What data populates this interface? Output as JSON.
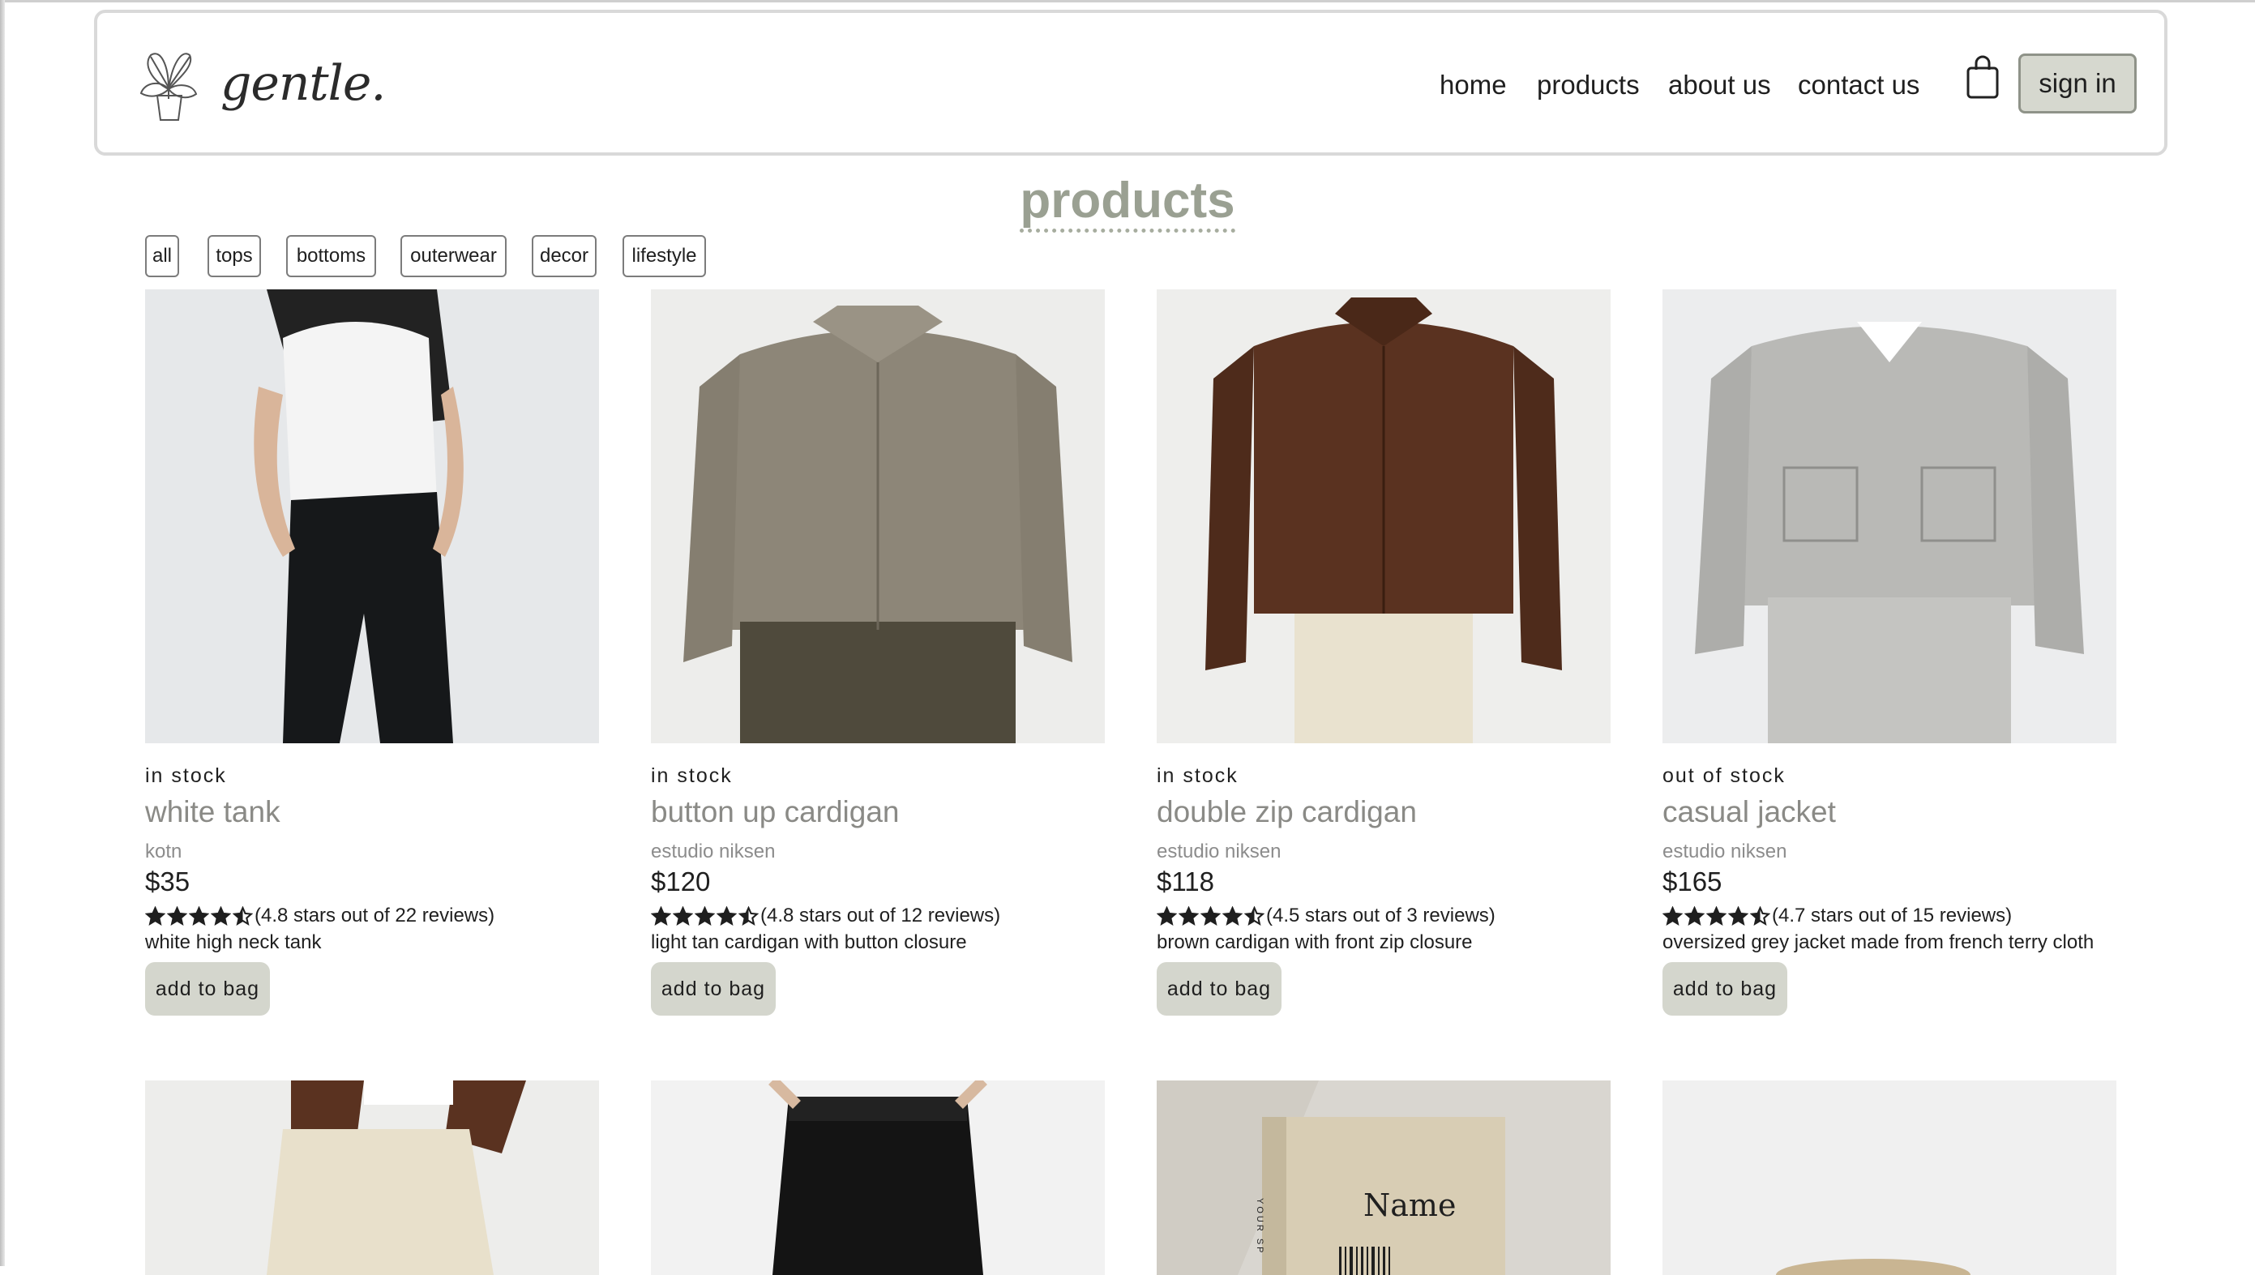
{
  "brand": {
    "logo_text": "gentle."
  },
  "nav": {
    "links": [
      "home",
      "products",
      "about us",
      "contact us"
    ],
    "signin_label": "sign in",
    "cart_icon": "shopping-bag-icon"
  },
  "page_title": "products",
  "filters": [
    "all",
    "tops",
    "bottoms",
    "outerwear",
    "decor",
    "lifestyle"
  ],
  "products": [
    {
      "stock": "in stock",
      "name": "white tank",
      "brand": "kotn",
      "price": "$35",
      "rating": 4.8,
      "rating_text": "(4.8 stars out of 22 reviews)",
      "description": "white high neck tank",
      "button": "add to bag"
    },
    {
      "stock": "in stock",
      "name": "button up cardigan",
      "brand": "estudio niksen",
      "price": "$120",
      "rating": 4.8,
      "rating_text": "(4.8 stars out of 12 reviews)",
      "description": "light tan cardigan with button closure",
      "button": "add to bag"
    },
    {
      "stock": "in stock",
      "name": "double zip cardigan",
      "brand": "estudio niksen",
      "price": "$118",
      "rating": 4.5,
      "rating_text": "(4.5 stars out of 3 reviews)",
      "description": "brown cardigan with front zip closure",
      "button": "add to bag"
    },
    {
      "stock": "out of stock",
      "name": "casual jacket",
      "brand": "estudio niksen",
      "price": "$165",
      "rating": 4.7,
      "rating_text": "(4.7 stars out of 15 reviews)",
      "description": "oversized grey jacket made from french terry cloth",
      "button": "add to bag"
    }
  ],
  "second_row_book_label": "Name",
  "second_row_book_spine": "YOUR SP",
  "colors": {
    "accent_title": "#9aa092",
    "button_bg": "#d4d6cd",
    "product_name": "#8a8a86"
  }
}
